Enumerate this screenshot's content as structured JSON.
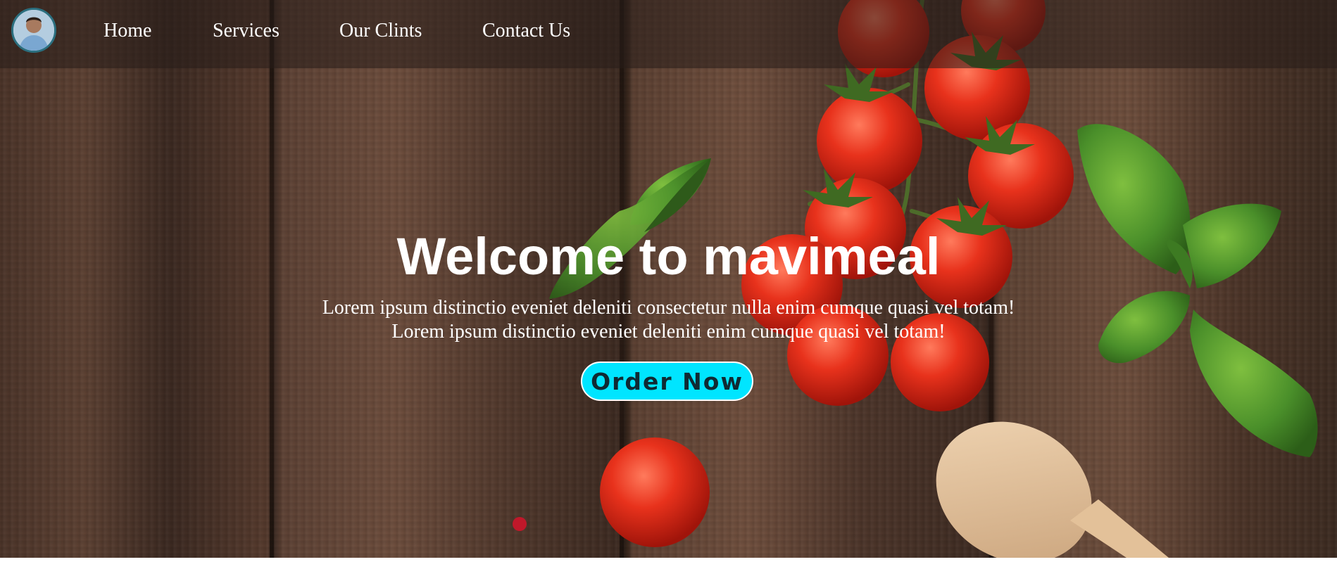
{
  "nav": {
    "avatar_alt": "profile avatar",
    "links": [
      {
        "label": "Home"
      },
      {
        "label": "Services"
      },
      {
        "label": "Our Clints"
      },
      {
        "label": "Contact Us"
      }
    ]
  },
  "hero": {
    "title": "Welcome to mavimeal",
    "text_line1": "Lorem ipsum distinctio eveniet deleniti consectetur nulla enim cumque quasi vel totam!",
    "text_line2": "Lorem ipsum distinctio eveniet deleniti enim cumque quasi vel totam!",
    "button_label": "Order Now"
  },
  "colors": {
    "button_bg": "#00e5ff",
    "button_text": "#0f2a33",
    "nav_overlay": "rgba(40,30,25,0.55)",
    "text": "#ffffff"
  }
}
